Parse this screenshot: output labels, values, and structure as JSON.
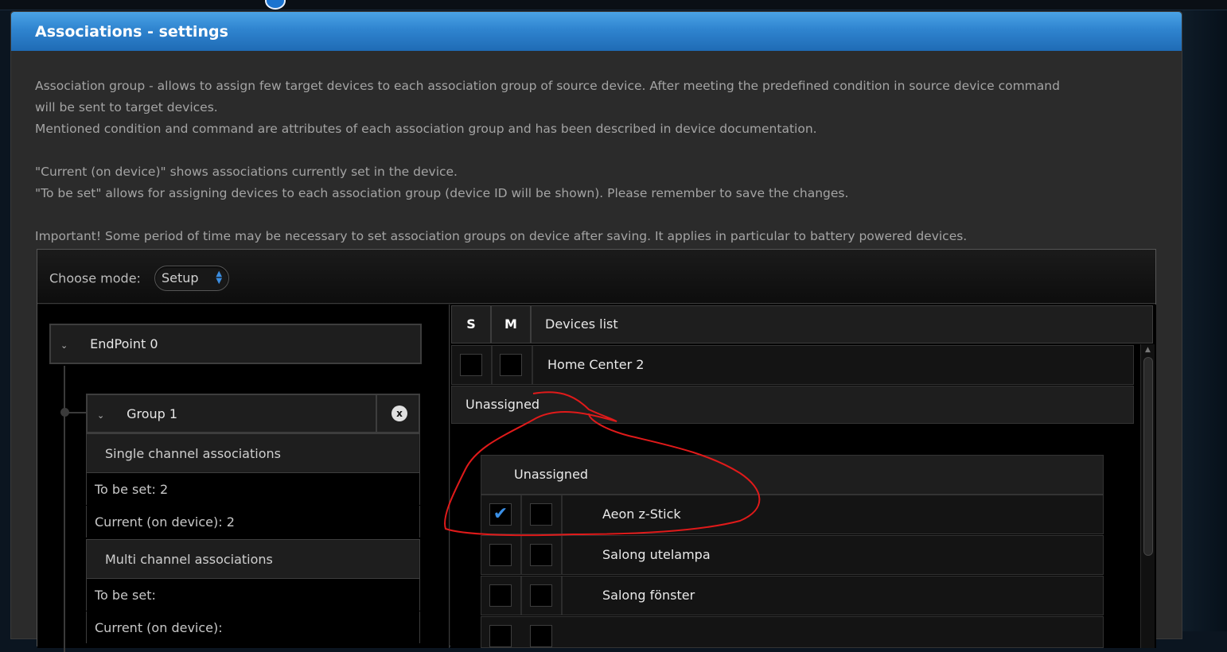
{
  "window": {
    "title": "Associations - settings"
  },
  "description": [
    "Association group - allows to assign few target devices to each association group of source device. After meeting the predefined condition in source device command",
    "will be sent to target devices.",
    "Mentioned condition and command are attributes of each association group and has been described in device documentation.",
    "",
    "\"Current (on device)\" shows associations currently set in the device.",
    "\"To be set\" allows for assigning devices to each association group (device ID will be shown). Please remember to save the changes.",
    "",
    "Important! Some period of time may be necessary to set association groups on device after saving. It applies in particular to battery powered devices."
  ],
  "mode": {
    "label": "Choose mode:",
    "value": "Setup"
  },
  "tree": {
    "endpoint": "EndPoint 0",
    "group": "Group 1",
    "close_icon": "x",
    "single": {
      "header": "Single channel associations",
      "to_be_set": "To be set: 2",
      "current": "Current (on device): 2"
    },
    "multi": {
      "header": "Multi channel associations",
      "to_be_set": "To be set:",
      "current": "Current (on device):"
    }
  },
  "devices": {
    "col_s": "S",
    "col_m": "M",
    "col_list": "Devices list",
    "top_device": "Home Center 2",
    "section": "Unassigned",
    "subsection": "Unassigned",
    "items": [
      {
        "name": "Aeon z-Stick",
        "s": true,
        "m": false
      },
      {
        "name": "Salong utelampa",
        "s": false,
        "m": false
      },
      {
        "name": "Salong fönster",
        "s": false,
        "m": false
      }
    ]
  },
  "colors": {
    "accent": "#2f84cf",
    "check": "#3a8fe6",
    "annotation": "#e01a1a"
  }
}
